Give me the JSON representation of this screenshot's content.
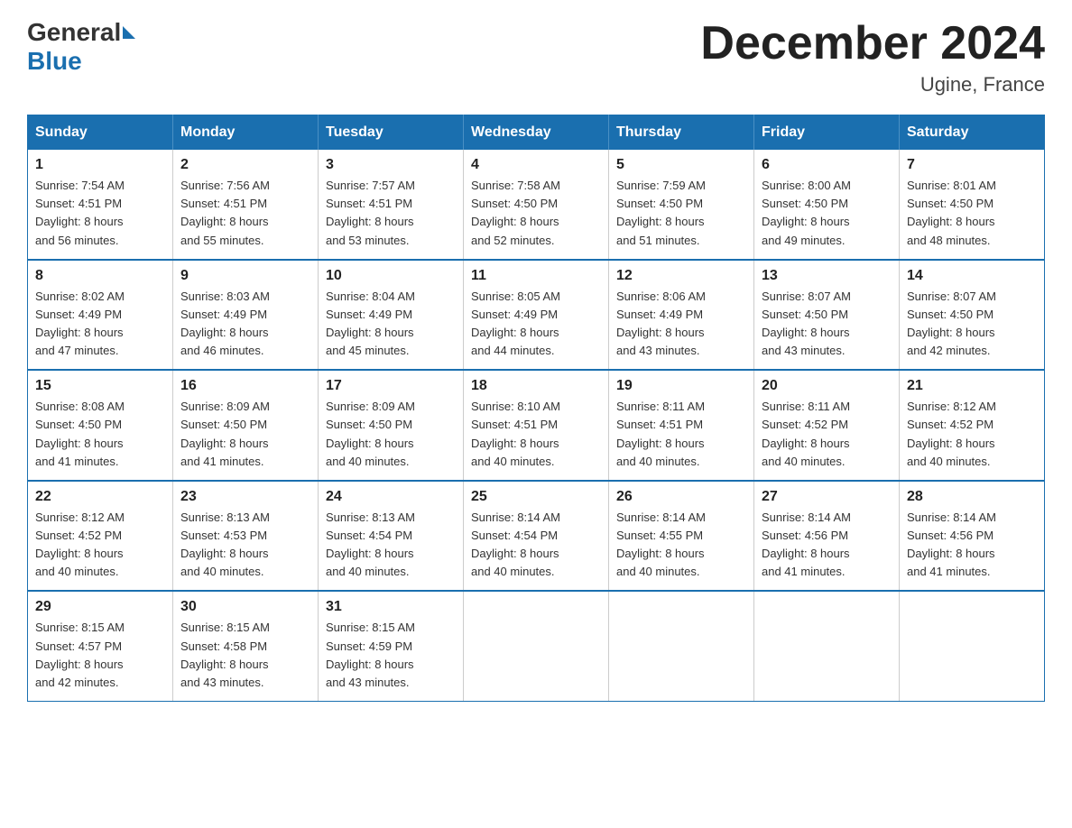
{
  "header": {
    "logo": {
      "general": "General",
      "blue": "Blue"
    },
    "title": "December 2024",
    "location": "Ugine, France"
  },
  "weekdays": [
    "Sunday",
    "Monday",
    "Tuesday",
    "Wednesday",
    "Thursday",
    "Friday",
    "Saturday"
  ],
  "weeks": [
    [
      {
        "day": "1",
        "sunrise": "7:54 AM",
        "sunset": "4:51 PM",
        "daylight": "8 hours and 56 minutes."
      },
      {
        "day": "2",
        "sunrise": "7:56 AM",
        "sunset": "4:51 PM",
        "daylight": "8 hours and 55 minutes."
      },
      {
        "day": "3",
        "sunrise": "7:57 AM",
        "sunset": "4:51 PM",
        "daylight": "8 hours and 53 minutes."
      },
      {
        "day": "4",
        "sunrise": "7:58 AM",
        "sunset": "4:50 PM",
        "daylight": "8 hours and 52 minutes."
      },
      {
        "day": "5",
        "sunrise": "7:59 AM",
        "sunset": "4:50 PM",
        "daylight": "8 hours and 51 minutes."
      },
      {
        "day": "6",
        "sunrise": "8:00 AM",
        "sunset": "4:50 PM",
        "daylight": "8 hours and 49 minutes."
      },
      {
        "day": "7",
        "sunrise": "8:01 AM",
        "sunset": "4:50 PM",
        "daylight": "8 hours and 48 minutes."
      }
    ],
    [
      {
        "day": "8",
        "sunrise": "8:02 AM",
        "sunset": "4:49 PM",
        "daylight": "8 hours and 47 minutes."
      },
      {
        "day": "9",
        "sunrise": "8:03 AM",
        "sunset": "4:49 PM",
        "daylight": "8 hours and 46 minutes."
      },
      {
        "day": "10",
        "sunrise": "8:04 AM",
        "sunset": "4:49 PM",
        "daylight": "8 hours and 45 minutes."
      },
      {
        "day": "11",
        "sunrise": "8:05 AM",
        "sunset": "4:49 PM",
        "daylight": "8 hours and 44 minutes."
      },
      {
        "day": "12",
        "sunrise": "8:06 AM",
        "sunset": "4:49 PM",
        "daylight": "8 hours and 43 minutes."
      },
      {
        "day": "13",
        "sunrise": "8:07 AM",
        "sunset": "4:50 PM",
        "daylight": "8 hours and 43 minutes."
      },
      {
        "day": "14",
        "sunrise": "8:07 AM",
        "sunset": "4:50 PM",
        "daylight": "8 hours and 42 minutes."
      }
    ],
    [
      {
        "day": "15",
        "sunrise": "8:08 AM",
        "sunset": "4:50 PM",
        "daylight": "8 hours and 41 minutes."
      },
      {
        "day": "16",
        "sunrise": "8:09 AM",
        "sunset": "4:50 PM",
        "daylight": "8 hours and 41 minutes."
      },
      {
        "day": "17",
        "sunrise": "8:09 AM",
        "sunset": "4:50 PM",
        "daylight": "8 hours and 40 minutes."
      },
      {
        "day": "18",
        "sunrise": "8:10 AM",
        "sunset": "4:51 PM",
        "daylight": "8 hours and 40 minutes."
      },
      {
        "day": "19",
        "sunrise": "8:11 AM",
        "sunset": "4:51 PM",
        "daylight": "8 hours and 40 minutes."
      },
      {
        "day": "20",
        "sunrise": "8:11 AM",
        "sunset": "4:52 PM",
        "daylight": "8 hours and 40 minutes."
      },
      {
        "day": "21",
        "sunrise": "8:12 AM",
        "sunset": "4:52 PM",
        "daylight": "8 hours and 40 minutes."
      }
    ],
    [
      {
        "day": "22",
        "sunrise": "8:12 AM",
        "sunset": "4:52 PM",
        "daylight": "8 hours and 40 minutes."
      },
      {
        "day": "23",
        "sunrise": "8:13 AM",
        "sunset": "4:53 PM",
        "daylight": "8 hours and 40 minutes."
      },
      {
        "day": "24",
        "sunrise": "8:13 AM",
        "sunset": "4:54 PM",
        "daylight": "8 hours and 40 minutes."
      },
      {
        "day": "25",
        "sunrise": "8:14 AM",
        "sunset": "4:54 PM",
        "daylight": "8 hours and 40 minutes."
      },
      {
        "day": "26",
        "sunrise": "8:14 AM",
        "sunset": "4:55 PM",
        "daylight": "8 hours and 40 minutes."
      },
      {
        "day": "27",
        "sunrise": "8:14 AM",
        "sunset": "4:56 PM",
        "daylight": "8 hours and 41 minutes."
      },
      {
        "day": "28",
        "sunrise": "8:14 AM",
        "sunset": "4:56 PM",
        "daylight": "8 hours and 41 minutes."
      }
    ],
    [
      {
        "day": "29",
        "sunrise": "8:15 AM",
        "sunset": "4:57 PM",
        "daylight": "8 hours and 42 minutes."
      },
      {
        "day": "30",
        "sunrise": "8:15 AM",
        "sunset": "4:58 PM",
        "daylight": "8 hours and 43 minutes."
      },
      {
        "day": "31",
        "sunrise": "8:15 AM",
        "sunset": "4:59 PM",
        "daylight": "8 hours and 43 minutes."
      },
      null,
      null,
      null,
      null
    ]
  ],
  "labels": {
    "sunrise": "Sunrise:",
    "sunset": "Sunset:",
    "daylight": "Daylight:"
  }
}
